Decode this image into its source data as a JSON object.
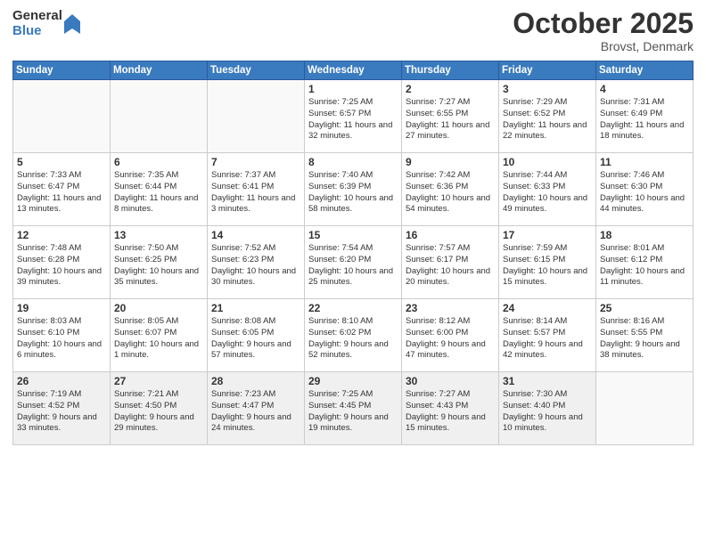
{
  "logo": {
    "general": "General",
    "blue": "Blue"
  },
  "header": {
    "month": "October 2025",
    "location": "Brovst, Denmark"
  },
  "weekdays": [
    "Sunday",
    "Monday",
    "Tuesday",
    "Wednesday",
    "Thursday",
    "Friday",
    "Saturday"
  ],
  "weeks": [
    [
      {
        "day": "",
        "sunrise": "",
        "sunset": "",
        "daylight": ""
      },
      {
        "day": "",
        "sunrise": "",
        "sunset": "",
        "daylight": ""
      },
      {
        "day": "",
        "sunrise": "",
        "sunset": "",
        "daylight": ""
      },
      {
        "day": "1",
        "sunrise": "Sunrise: 7:25 AM",
        "sunset": "Sunset: 6:57 PM",
        "daylight": "Daylight: 11 hours and 32 minutes."
      },
      {
        "day": "2",
        "sunrise": "Sunrise: 7:27 AM",
        "sunset": "Sunset: 6:55 PM",
        "daylight": "Daylight: 11 hours and 27 minutes."
      },
      {
        "day": "3",
        "sunrise": "Sunrise: 7:29 AM",
        "sunset": "Sunset: 6:52 PM",
        "daylight": "Daylight: 11 hours and 22 minutes."
      },
      {
        "day": "4",
        "sunrise": "Sunrise: 7:31 AM",
        "sunset": "Sunset: 6:49 PM",
        "daylight": "Daylight: 11 hours and 18 minutes."
      }
    ],
    [
      {
        "day": "5",
        "sunrise": "Sunrise: 7:33 AM",
        "sunset": "Sunset: 6:47 PM",
        "daylight": "Daylight: 11 hours and 13 minutes."
      },
      {
        "day": "6",
        "sunrise": "Sunrise: 7:35 AM",
        "sunset": "Sunset: 6:44 PM",
        "daylight": "Daylight: 11 hours and 8 minutes."
      },
      {
        "day": "7",
        "sunrise": "Sunrise: 7:37 AM",
        "sunset": "Sunset: 6:41 PM",
        "daylight": "Daylight: 11 hours and 3 minutes."
      },
      {
        "day": "8",
        "sunrise": "Sunrise: 7:40 AM",
        "sunset": "Sunset: 6:39 PM",
        "daylight": "Daylight: 10 hours and 58 minutes."
      },
      {
        "day": "9",
        "sunrise": "Sunrise: 7:42 AM",
        "sunset": "Sunset: 6:36 PM",
        "daylight": "Daylight: 10 hours and 54 minutes."
      },
      {
        "day": "10",
        "sunrise": "Sunrise: 7:44 AM",
        "sunset": "Sunset: 6:33 PM",
        "daylight": "Daylight: 10 hours and 49 minutes."
      },
      {
        "day": "11",
        "sunrise": "Sunrise: 7:46 AM",
        "sunset": "Sunset: 6:30 PM",
        "daylight": "Daylight: 10 hours and 44 minutes."
      }
    ],
    [
      {
        "day": "12",
        "sunrise": "Sunrise: 7:48 AM",
        "sunset": "Sunset: 6:28 PM",
        "daylight": "Daylight: 10 hours and 39 minutes."
      },
      {
        "day": "13",
        "sunrise": "Sunrise: 7:50 AM",
        "sunset": "Sunset: 6:25 PM",
        "daylight": "Daylight: 10 hours and 35 minutes."
      },
      {
        "day": "14",
        "sunrise": "Sunrise: 7:52 AM",
        "sunset": "Sunset: 6:23 PM",
        "daylight": "Daylight: 10 hours and 30 minutes."
      },
      {
        "day": "15",
        "sunrise": "Sunrise: 7:54 AM",
        "sunset": "Sunset: 6:20 PM",
        "daylight": "Daylight: 10 hours and 25 minutes."
      },
      {
        "day": "16",
        "sunrise": "Sunrise: 7:57 AM",
        "sunset": "Sunset: 6:17 PM",
        "daylight": "Daylight: 10 hours and 20 minutes."
      },
      {
        "day": "17",
        "sunrise": "Sunrise: 7:59 AM",
        "sunset": "Sunset: 6:15 PM",
        "daylight": "Daylight: 10 hours and 15 minutes."
      },
      {
        "day": "18",
        "sunrise": "Sunrise: 8:01 AM",
        "sunset": "Sunset: 6:12 PM",
        "daylight": "Daylight: 10 hours and 11 minutes."
      }
    ],
    [
      {
        "day": "19",
        "sunrise": "Sunrise: 8:03 AM",
        "sunset": "Sunset: 6:10 PM",
        "daylight": "Daylight: 10 hours and 6 minutes."
      },
      {
        "day": "20",
        "sunrise": "Sunrise: 8:05 AM",
        "sunset": "Sunset: 6:07 PM",
        "daylight": "Daylight: 10 hours and 1 minute."
      },
      {
        "day": "21",
        "sunrise": "Sunrise: 8:08 AM",
        "sunset": "Sunset: 6:05 PM",
        "daylight": "Daylight: 9 hours and 57 minutes."
      },
      {
        "day": "22",
        "sunrise": "Sunrise: 8:10 AM",
        "sunset": "Sunset: 6:02 PM",
        "daylight": "Daylight: 9 hours and 52 minutes."
      },
      {
        "day": "23",
        "sunrise": "Sunrise: 8:12 AM",
        "sunset": "Sunset: 6:00 PM",
        "daylight": "Daylight: 9 hours and 47 minutes."
      },
      {
        "day": "24",
        "sunrise": "Sunrise: 8:14 AM",
        "sunset": "Sunset: 5:57 PM",
        "daylight": "Daylight: 9 hours and 42 minutes."
      },
      {
        "day": "25",
        "sunrise": "Sunrise: 8:16 AM",
        "sunset": "Sunset: 5:55 PM",
        "daylight": "Daylight: 9 hours and 38 minutes."
      }
    ],
    [
      {
        "day": "26",
        "sunrise": "Sunrise: 7:19 AM",
        "sunset": "Sunset: 4:52 PM",
        "daylight": "Daylight: 9 hours and 33 minutes."
      },
      {
        "day": "27",
        "sunrise": "Sunrise: 7:21 AM",
        "sunset": "Sunset: 4:50 PM",
        "daylight": "Daylight: 9 hours and 29 minutes."
      },
      {
        "day": "28",
        "sunrise": "Sunrise: 7:23 AM",
        "sunset": "Sunset: 4:47 PM",
        "daylight": "Daylight: 9 hours and 24 minutes."
      },
      {
        "day": "29",
        "sunrise": "Sunrise: 7:25 AM",
        "sunset": "Sunset: 4:45 PM",
        "daylight": "Daylight: 9 hours and 19 minutes."
      },
      {
        "day": "30",
        "sunrise": "Sunrise: 7:27 AM",
        "sunset": "Sunset: 4:43 PM",
        "daylight": "Daylight: 9 hours and 15 minutes."
      },
      {
        "day": "31",
        "sunrise": "Sunrise: 7:30 AM",
        "sunset": "Sunset: 4:40 PM",
        "daylight": "Daylight: 9 hours and 10 minutes."
      },
      {
        "day": "",
        "sunrise": "",
        "sunset": "",
        "daylight": ""
      }
    ]
  ]
}
